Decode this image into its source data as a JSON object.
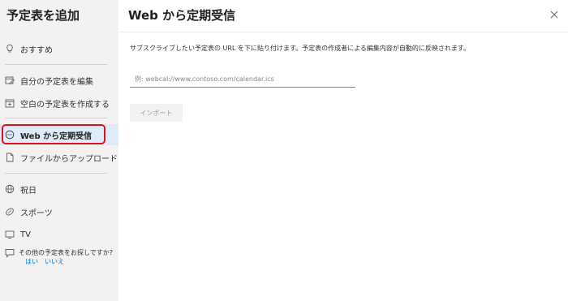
{
  "sidebar": {
    "title": "予定表を追加",
    "items": [
      {
        "label": "おすすめ",
        "icon": "lightbulb-icon"
      },
      {
        "label": "自分の予定表を編集",
        "icon": "edit-calendar-icon"
      },
      {
        "label": "空白の予定表を作成する",
        "icon": "add-calendar-icon"
      },
      {
        "label": "Web から定期受信",
        "icon": "subscribe-web-icon",
        "selected": true
      },
      {
        "label": "ファイルからアップロード",
        "icon": "file-upload-icon"
      },
      {
        "label": "祝日",
        "icon": "globe-icon"
      },
      {
        "label": "スポーツ",
        "icon": "sports-ball-icon"
      },
      {
        "label": "TV",
        "icon": "tv-icon"
      }
    ],
    "footer": {
      "question": "その他の予定表をお探しですか?",
      "yes": "はい",
      "no": "いいえ",
      "icon": "feedback-icon"
    }
  },
  "main": {
    "title": "Web から定期受信",
    "description": "サブスクライブしたい予定表の URL を下に貼り付けます。予定表の作成者による編集内容が自動的に反映されます。",
    "url_placeholder": "例: webcal://www.contoso.com/calendar.ics",
    "url_value": "",
    "import_label": "インポート",
    "close_icon": "close-icon"
  },
  "colors": {
    "sidebar_bg": "#f3f2f1",
    "selected_bg": "#deecf9",
    "highlight_border": "#e0101a",
    "link": "#0078d4"
  }
}
